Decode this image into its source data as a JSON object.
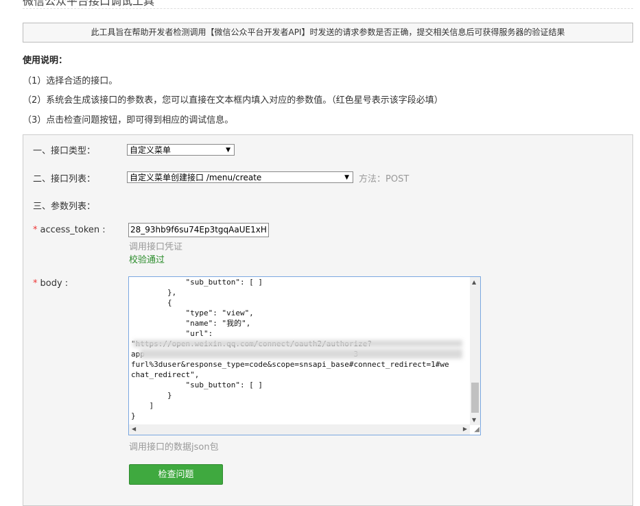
{
  "page_title": "微信公众平台接口调试工具",
  "notice": "此工具旨在帮助开发者检测调用【微信公众平台开发者API】时发送的请求参数是否正确，提交相关信息后可获得服务器的验证结果",
  "usage": {
    "title": "使用说明：",
    "steps": [
      "（1）选择合适的接口。",
      "（2）系统会生成该接口的参数表，您可以直接在文本框内填入对应的参数值。（红色星号表示该字段必填）",
      "（3）点击检查问题按钮，即可得到相应的调试信息。"
    ]
  },
  "form": {
    "api_type_label": "一、接口类型：",
    "api_type_value": "自定义菜单",
    "api_list_label": "二、接口列表：",
    "api_list_value": "自定义菜单创建接口 /menu/create",
    "method_text": "方法：POST",
    "params_label": "三、参数列表：",
    "required_mark": "*",
    "access_token_label": "access_token :",
    "access_token_value": "28_93hb9f6su74Ep3tgqAaUE1xH",
    "access_token_hint": "调用接口凭证",
    "access_token_status": "校验通过",
    "body_label": "body :",
    "body_value": "            \"sub_button\": [ ]\n        },\n        {\n            \"type\": \"view\",\n            \"name\": \"我的\",\n            \"url\":\n\"https://open.weixin.qq.com/connect/oauth2/authorize?\napp                                              3\nfurl%3duser&response_type=code&scope=snsapi_base#connect_redirect=1#we\nchat_redirect\",\n            \"sub_button\": [ ]\n        }\n    ]\n}",
    "body_hint": "调用接口的数据json包",
    "submit_label": "检查问题"
  },
  "colors": {
    "required": "#e33333",
    "success": "#2a8c2a",
    "button": "#3fa93f",
    "textarea_border": "#7aa7e0"
  }
}
